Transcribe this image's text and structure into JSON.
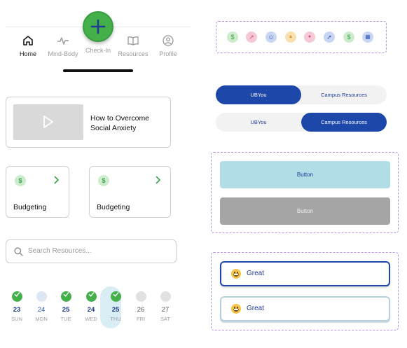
{
  "nav": {
    "items": [
      {
        "label": "Home",
        "icon": "home-icon"
      },
      {
        "label": "Mind-Body",
        "icon": "pulse-icon"
      },
      {
        "label": "Check-In",
        "icon": "plus-icon"
      },
      {
        "label": "Resources",
        "icon": "book-icon"
      },
      {
        "label": "Profile",
        "icon": "profile-icon"
      }
    ],
    "active": "Home",
    "fab_color": "#43b04a"
  },
  "video_card": {
    "title": "How to Overcome Social Anxiety",
    "icon": "play-icon"
  },
  "mini_cards": [
    {
      "title": "Budgeting",
      "icon": "dollar-icon",
      "symbol": "$"
    },
    {
      "title": "Budgeting",
      "icon": "dollar-icon",
      "symbol": "$"
    }
  ],
  "search": {
    "placeholder": "Search Resources..."
  },
  "week": [
    {
      "num": "23",
      "name": "SUN",
      "state": "done"
    },
    {
      "num": "24",
      "name": "MON",
      "state": "missed"
    },
    {
      "num": "25",
      "name": "TUE",
      "state": "done"
    },
    {
      "num": "24",
      "name": "WED",
      "state": "done"
    },
    {
      "num": "25",
      "name": "THU",
      "state": "done",
      "selected": true
    },
    {
      "num": "26",
      "name": "FRI",
      "state": "future"
    },
    {
      "num": "27",
      "name": "SAT",
      "state": "future"
    }
  ],
  "category_icons": [
    {
      "name": "dollar-icon",
      "glyph": "$",
      "bg": "#cdeccd",
      "fg": "#3aa24a"
    },
    {
      "name": "trend-icon",
      "glyph": "↗",
      "bg": "#f6c8d6",
      "fg": "#d0497a"
    },
    {
      "name": "smile-icon",
      "glyph": "☺",
      "bg": "#c9d6f2",
      "fg": "#3b5bb8"
    },
    {
      "name": "graduation-icon",
      "glyph": "▲",
      "bg": "#f9e0b0",
      "fg": "#d8962a"
    },
    {
      "name": "people-icon",
      "glyph": "●",
      "bg": "#f6c8d6",
      "fg": "#d0497a"
    },
    {
      "name": "rocket-icon",
      "glyph": "➚",
      "bg": "#c9d6f2",
      "fg": "#2c4fb0"
    },
    {
      "name": "dollar-icon",
      "glyph": "$",
      "bg": "#cdeccd",
      "fg": "#3aa24a"
    },
    {
      "name": "building-icon",
      "glyph": "▦",
      "bg": "#c9d6f2",
      "fg": "#3b5bb8"
    }
  ],
  "segmented": [
    {
      "options": [
        "UBYou",
        "Campus Resources"
      ],
      "selected": 0
    },
    {
      "options": [
        "UBYou",
        "Campus Resources"
      ],
      "selected": 1
    }
  ],
  "buttons": {
    "primary_label": "Button",
    "disabled_label": "Button"
  },
  "moods": [
    {
      "label": "Great",
      "icon": "grin-emoji-icon"
    },
    {
      "label": "Great",
      "icon": "grin-emoji-icon"
    }
  ],
  "colors": {
    "brand_blue": "#1d47a8",
    "success_green": "#43b04a",
    "accent_purple_dashed": "#b890e6"
  }
}
